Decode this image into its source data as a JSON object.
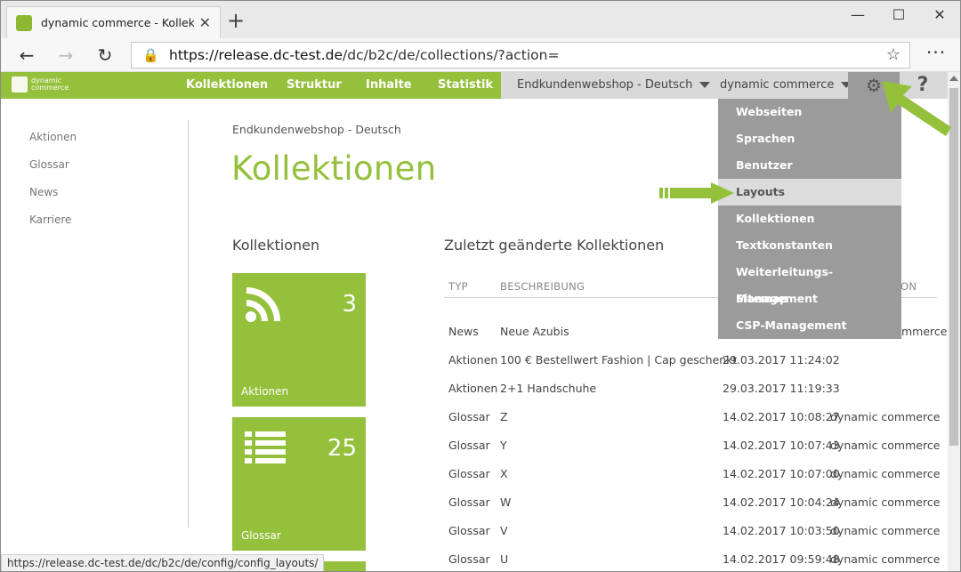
{
  "browser": {
    "tab_title": "dynamic commerce - Kollektione",
    "url_host": "https://release.dc-test.de",
    "url_path": "/dc/b2c/de/collections/?action=",
    "status_url": "https://release.dc-test.de/dc/b2c/de/config/config_layouts/"
  },
  "app": {
    "logo_text_line1": "dynamic",
    "logo_text_line2": "commerce",
    "nav": [
      "Kollektionen",
      "Struktur",
      "Inhalte",
      "Statistik"
    ],
    "shop_select": "Endkundenwebshop - Deutsch",
    "company_select": "dynamic commerce",
    "help_label": "?"
  },
  "sidebar": {
    "items": [
      "Aktionen",
      "Glossar",
      "News",
      "Karriere"
    ]
  },
  "main": {
    "breadcrumb": "Endkundenwebshop - Deutsch",
    "title": "Kollektionen",
    "left_heading": "Kollektionen",
    "right_heading": "Zuletzt geänderte Kollektionen",
    "tiles": [
      {
        "label": "Aktionen",
        "count": "3",
        "icon": "rss-icon"
      },
      {
        "label": "Glossar",
        "count": "25",
        "icon": "list-icon"
      }
    ],
    "table": {
      "headers": [
        "TYP",
        "BESCHREIBUNG",
        "ON"
      ],
      "rows": [
        {
          "type": "News",
          "desc": "Neue Azubis",
          "date": "",
          "user": "mmerce"
        },
        {
          "type": "Aktionen",
          "desc": "100 € Bestellwert Fashion | Cap geschenkt",
          "date": "29.03.2017 11:24:02",
          "user": ""
        },
        {
          "type": "Aktionen",
          "desc": "2+1 Handschuhe",
          "date": "29.03.2017 11:19:33",
          "user": ""
        },
        {
          "type": "Glossar",
          "desc": "Z",
          "date": "14.02.2017 10:08:27",
          "user": "dynamic commerce"
        },
        {
          "type": "Glossar",
          "desc": "Y",
          "date": "14.02.2017 10:07:43",
          "user": "dynamic commerce"
        },
        {
          "type": "Glossar",
          "desc": "X",
          "date": "14.02.2017 10:07:00",
          "user": "dynamic commerce"
        },
        {
          "type": "Glossar",
          "desc": "W",
          "date": "14.02.2017 10:04:24",
          "user": "dynamic commerce"
        },
        {
          "type": "Glossar",
          "desc": "V",
          "date": "14.02.2017 10:03:50",
          "user": "dynamic commerce"
        },
        {
          "type": "Glossar",
          "desc": "U",
          "date": "14.02.2017 09:59:48",
          "user": "dynamic commerce"
        }
      ]
    }
  },
  "settings_menu": {
    "items": [
      "Webseiten",
      "Sprachen",
      "Benutzer",
      "Layouts",
      "Kollektionen",
      "Textkonstanten",
      "Weiterleitungs-Management",
      "Sitemap",
      "CSP-Management"
    ],
    "active": "Layouts"
  },
  "colors": {
    "brand_green": "#94c03c",
    "menu_gray": "#9b9b9b",
    "active_item": "#dcdcdc"
  }
}
